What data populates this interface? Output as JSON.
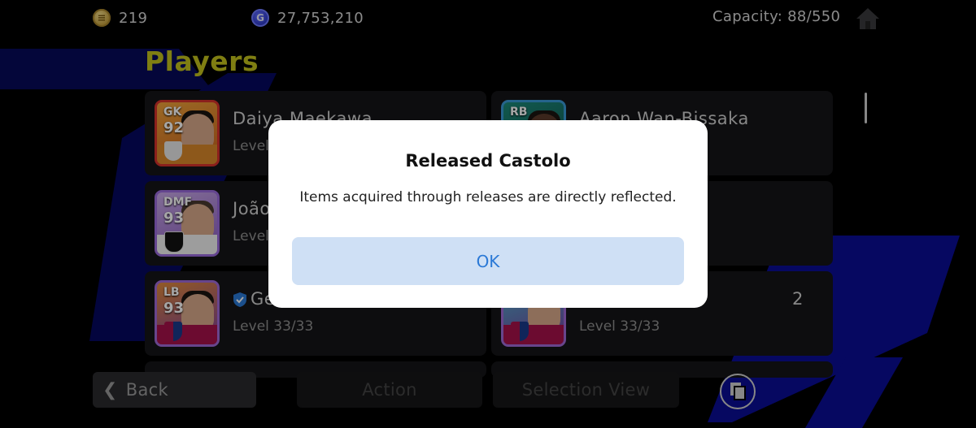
{
  "header": {
    "coins": "219",
    "coin_icon": "coin-icon",
    "gp": "27,753,210",
    "gp_icon_letter": "G",
    "capacity": "Capacity: 88/550",
    "home_icon": "home-icon"
  },
  "page": {
    "title": "Players"
  },
  "players": [
    {
      "position": "GK",
      "rating": "92",
      "name": "Daiya Maekawa",
      "level": "Level"
    },
    {
      "position": "RB",
      "rating": "",
      "name": "Aaron Wan-Bissaka",
      "level": ""
    },
    {
      "position": "DMF",
      "rating": "93",
      "name": "João",
      "level": "Level"
    },
    {
      "position": "LB",
      "rating": "93",
      "name": "Ge",
      "level": "Level 33/33"
    },
    {
      "position": "",
      "rating": "",
      "name": "2",
      "level": "Level 33/33"
    }
  ],
  "toolbar": {
    "back_label": "Back",
    "action_label": "Action",
    "selection_view_label": "Selection View"
  },
  "dialog": {
    "title": "Released Castolo",
    "message": "Items acquired through releases are directly reflected.",
    "ok_label": "OK"
  },
  "colors": {
    "title": "#c3c21c",
    "ok_button_bg": "#cfe0f5",
    "ok_button_text": "#2b79d6",
    "background_stripe": "#0b0f8f"
  }
}
